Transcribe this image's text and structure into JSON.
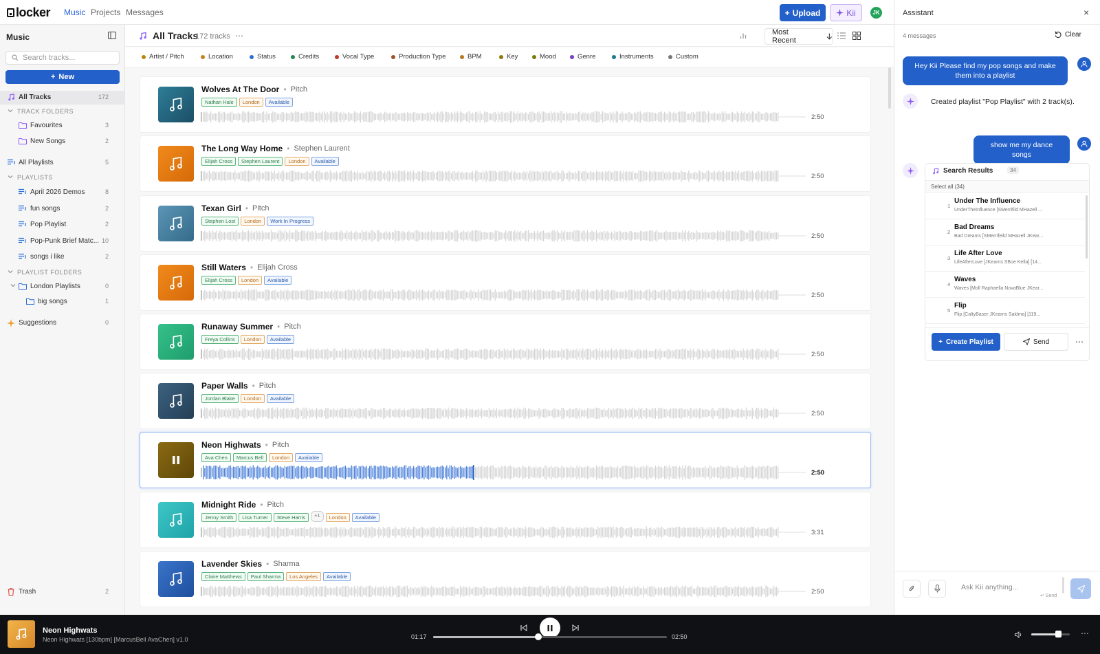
{
  "app": {
    "logo": "locker"
  },
  "nav": {
    "music": "Music",
    "projects": "Projects",
    "messages": "Messages",
    "upload": "Upload",
    "kii": "Kii",
    "avatar": "JK"
  },
  "sidebar": {
    "title": "Music",
    "search_placeholder": "Search tracks...",
    "new_label": "New",
    "all_tracks": {
      "label": "All Tracks",
      "count": "172"
    },
    "track_folders_head": "TRACK FOLDERS",
    "track_folders": [
      {
        "label": "Favourites",
        "count": "3"
      },
      {
        "label": "New Songs",
        "count": "2"
      }
    ],
    "all_playlists": {
      "label": "All Playlists",
      "count": "5"
    },
    "playlists_head": "PLAYLISTS",
    "playlists": [
      {
        "label": "April 2026 Demos",
        "count": "8"
      },
      {
        "label": "fun songs",
        "count": "2"
      },
      {
        "label": "Pop Playlist",
        "count": "2"
      },
      {
        "label": "Pop-Punk Brief Matc...",
        "count": "10"
      },
      {
        "label": "songs i like",
        "count": "2"
      }
    ],
    "playlist_folders_head": "PLAYLIST FOLDERS",
    "playlist_folders": [
      {
        "label": "London Playlists",
        "count": "0"
      },
      {
        "label": "big songs",
        "count": "1"
      }
    ],
    "suggestions": {
      "label": "Suggestions",
      "count": "0"
    },
    "trash": {
      "label": "Trash",
      "count": "2"
    }
  },
  "main": {
    "title": "All Tracks",
    "count": "172 tracks",
    "sort": "Most Recent",
    "filters": [
      {
        "label": "Artist / Pitch",
        "color": "#b8860b"
      },
      {
        "label": "Location",
        "color": "#c9801e"
      },
      {
        "label": "Status",
        "color": "#2a6fd6"
      },
      {
        "label": "Credits",
        "color": "#1f8a4c"
      },
      {
        "label": "Vocal Type",
        "color": "#c0392b"
      },
      {
        "label": "Production Type",
        "color": "#a0522d"
      },
      {
        "label": "BPM",
        "color": "#b7791f"
      },
      {
        "label": "Key",
        "color": "#8a7a0c"
      },
      {
        "label": "Mood",
        "color": "#7a7a0c"
      },
      {
        "label": "Genre",
        "color": "#7b3fc4"
      },
      {
        "label": "Instruments",
        "color": "#1f7a8c"
      },
      {
        "label": "Custom",
        "color": "#777777"
      }
    ],
    "tracks": [
      {
        "title": "Wolves At The Door",
        "artist": "Pitch",
        "tags": [
          {
            "t": "Nathan Hale",
            "c": "g"
          },
          {
            "t": "London",
            "c": "o"
          },
          {
            "t": "Available",
            "c": "b"
          }
        ],
        "duration": "2:50",
        "color1": "#2e7d97",
        "color2": "#1b4f66",
        "progress": 0
      },
      {
        "title": "The Long Way Home",
        "artist": "Stephen Laurent",
        "tags": [
          {
            "t": "Elijah Cross",
            "c": "g"
          },
          {
            "t": "Stephen Laurent",
            "c": "g"
          },
          {
            "t": "London",
            "c": "o"
          },
          {
            "t": "Available",
            "c": "b"
          }
        ],
        "duration": "2:50",
        "color1": "#f08a1c",
        "color2": "#d66a08",
        "progress": 0
      },
      {
        "title": "Texan Girl",
        "artist": "Pitch",
        "tags": [
          {
            "t": "Stephen Lost",
            "c": "g"
          },
          {
            "t": "London",
            "c": "o"
          },
          {
            "t": "Work In Progress",
            "c": "b"
          }
        ],
        "duration": "2:50",
        "color1": "#5b95b5",
        "color2": "#356b8a",
        "progress": 0
      },
      {
        "title": "Still Waters",
        "artist": "Elijah Cross",
        "tags": [
          {
            "t": "Elijah Cross",
            "c": "g"
          },
          {
            "t": "London",
            "c": "o"
          },
          {
            "t": "Available",
            "c": "b"
          }
        ],
        "duration": "2:50",
        "color1": "#f08a1c",
        "color2": "#d66a08",
        "progress": 0
      },
      {
        "title": "Runaway Summer",
        "artist": "Pitch",
        "tags": [
          {
            "t": "Freya Collins",
            "c": "g"
          },
          {
            "t": "London",
            "c": "o"
          },
          {
            "t": "Available",
            "c": "b"
          }
        ],
        "duration": "2:50",
        "color1": "#36c08a",
        "color2": "#1e9e6c",
        "progress": 0
      },
      {
        "title": "Paper Walls",
        "artist": "Pitch",
        "tags": [
          {
            "t": "Jordan Blake",
            "c": "g"
          },
          {
            "t": "London",
            "c": "o"
          },
          {
            "t": "Available",
            "c": "b"
          }
        ],
        "duration": "2:50",
        "color1": "#3c6280",
        "color2": "#243f56",
        "progress": 0
      },
      {
        "title": "Neon Highwats",
        "artist": "Pitch",
        "tags": [
          {
            "t": "Ava Chen",
            "c": "g"
          },
          {
            "t": "Marcus Bell",
            "c": "g"
          },
          {
            "t": "London",
            "c": "o"
          },
          {
            "t": "Available",
            "c": "b"
          }
        ],
        "duration": "2:50",
        "color1": "#8a6a14",
        "color2": "#5f4708",
        "progress": 0.45,
        "playing": true
      },
      {
        "title": "Midnight Ride",
        "artist": "Pitch",
        "tags": [
          {
            "t": "Jenny Smith",
            "c": "g"
          },
          {
            "t": "Lisa Turner",
            "c": "g"
          },
          {
            "t": "Steve Harris",
            "c": "g"
          },
          {
            "t": "+1",
            "c": "gr"
          },
          {
            "t": "London",
            "c": "o"
          },
          {
            "t": "Available",
            "c": "b"
          }
        ],
        "duration": "3:31",
        "color1": "#3ec6c6",
        "color2": "#1fa3a8",
        "progress": 0
      },
      {
        "title": "Lavender Skies",
        "artist": "Sharma",
        "tags": [
          {
            "t": "Claire Matthews",
            "c": "g"
          },
          {
            "t": "Paul Sharma",
            "c": "g"
          },
          {
            "t": "Los Angeles",
            "c": "o"
          },
          {
            "t": "Available",
            "c": "b"
          }
        ],
        "duration": "2:50",
        "color1": "#3a74c9",
        "color2": "#1f4f9e",
        "progress": 0
      }
    ]
  },
  "player": {
    "title": "Neon Highwats",
    "subtitle": "Neon Highwats [130bpm] [MarcusBell AvaChen] v1.0",
    "elapsed": "01:17",
    "total": "02:50",
    "progress": 0.45,
    "volume": 0.7
  },
  "assistant": {
    "title": "Assistant",
    "messages_count": "4 messages",
    "clear": "Clear",
    "msg1": "Hey Kii Please find my pop songs and make them into a playlist",
    "reply1": "Created playlist \"Pop Playlist\" with 2 track(s).",
    "msg2": "show me my dance songs",
    "results_title": "Search Results",
    "results_count": "34",
    "select_all": "Select all (34)",
    "results": [
      {
        "n": "1",
        "title": "Under The Influence",
        "sub": "UnderTheInfluence [SMerrifild MHazell ..."
      },
      {
        "n": "2",
        "title": "Bad Dreams",
        "sub": "Bad Dreams [SMerrifeild MHazell JKear..."
      },
      {
        "n": "3",
        "title": "Life After Love",
        "sub": "LifeAfterLove [JKearns SBoe Kella] [14..."
      },
      {
        "n": "4",
        "title": "Waves",
        "sub": "Waves [Moll Raphaella NovaBlue JKear..."
      },
      {
        "n": "5",
        "title": "Flip",
        "sub": "Flip [CaltyBaser JKearns Saklma] [119..."
      }
    ],
    "create_playlist": "Create Playlist",
    "send": "Send",
    "input_placeholder": "Ask Kii anything...",
    "send_hint": "↵ Send"
  }
}
